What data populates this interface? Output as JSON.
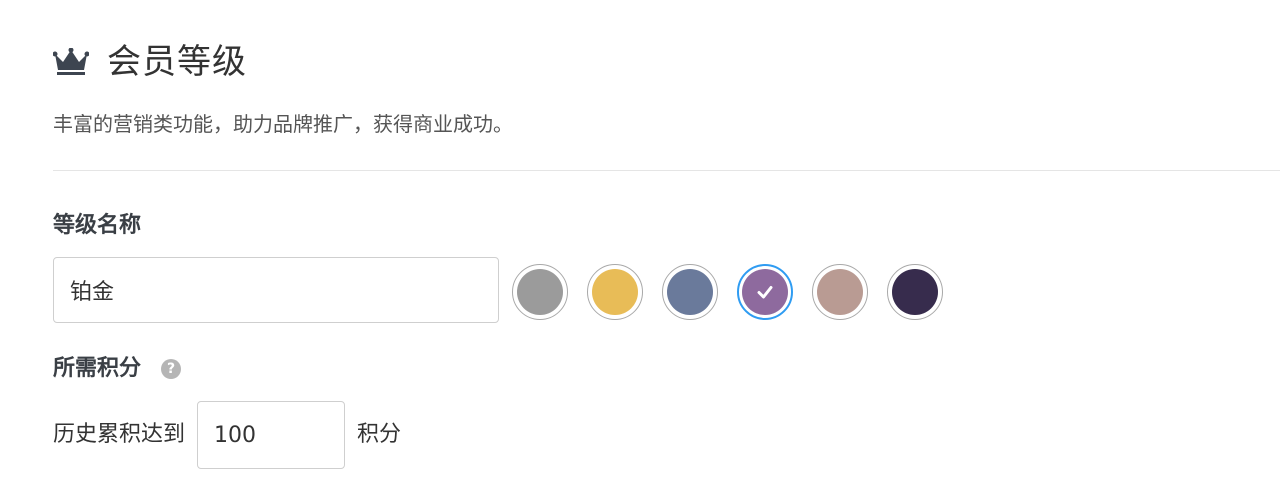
{
  "header": {
    "title": "会员等级",
    "icon": "crown-icon",
    "subtitle": "丰富的营销类功能，助力品牌推广，获得商业成功。"
  },
  "level_name": {
    "label": "等级名称",
    "value": "铂金"
  },
  "colors": {
    "selected_index": 3,
    "border_selected": "#2f9cf2",
    "options": [
      {
        "name": "gray",
        "hex": "#9b9b9b"
      },
      {
        "name": "gold",
        "hex": "#e8bc57"
      },
      {
        "name": "slate-blue",
        "hex": "#6a7a9b"
      },
      {
        "name": "purple",
        "hex": "#8e6a9e"
      },
      {
        "name": "rose-taupe",
        "hex": "#b99b93"
      },
      {
        "name": "dark-indigo",
        "hex": "#372c4d"
      }
    ]
  },
  "points": {
    "label": "所需积分",
    "help_icon": "question-circle-icon",
    "prefix": "历史累积达到",
    "value": "100",
    "suffix": "积分"
  }
}
